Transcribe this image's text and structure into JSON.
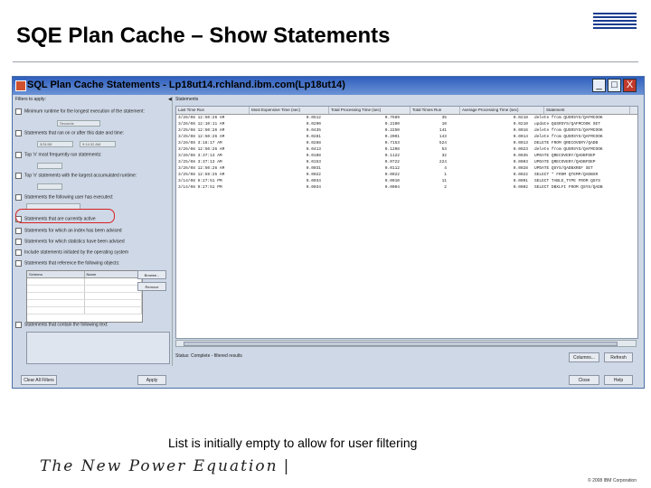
{
  "slide": {
    "title": "SQE Plan Cache – Show Statements",
    "logo": "IBM",
    "caption": "List is initially empty to allow for user filtering",
    "footer_brand": "The New Power Equation",
    "copyright": "© 2008 IBM Corporation"
  },
  "window": {
    "title": "SQL Plan Cache Statements - Lp18ut14.rchland.ibm.com(Lp18ut14)",
    "controls": {
      "minimize": "_",
      "maximize": "□",
      "close": "X"
    },
    "filters_label": "Filters to apply:",
    "filters": [
      {
        "label": "Minimum runtime for the longest execution of the statement:",
        "checked": false
      },
      {
        "label": "Statements that ran on or after this date and time:",
        "checked": false
      },
      {
        "label": "Top 'n' most frequently run statements:",
        "checked": false
      },
      {
        "label": "Top 'n' statements with the largest accumulated runtime:",
        "checked": false
      },
      {
        "label": "Statements the following user has executed:",
        "checked": false
      },
      {
        "label": "Statements that are currently active",
        "checked": false,
        "highlighted": true
      },
      {
        "label": "Statements for which an index has been advised",
        "checked": false
      },
      {
        "label": "Statements for which statistics have been advised",
        "checked": false
      },
      {
        "label": "Include statements initiated by the operating system",
        "checked": false
      },
      {
        "label": "Statements that reference the following objects:",
        "checked": false
      },
      {
        "label": "Statements that contain the following text:",
        "checked": false
      }
    ],
    "subfields": {
      "runtime_unit": "Seconds",
      "date": "3/31/08",
      "time": "9:14:32 AM"
    },
    "object_table": {
      "columns": [
        "Schema",
        "Name"
      ]
    },
    "object_buttons": {
      "browse": "Browse...",
      "remove": "Remove"
    },
    "buttons": {
      "clear_all_filters": "Clear All Filters",
      "apply": "Apply",
      "columns": "Columns...",
      "refresh": "Refresh",
      "close": "Close",
      "help": "Help"
    },
    "statements_label": "Statements",
    "table": {
      "columns": [
        "Last Time Run",
        "Most Expensive Time (sec)",
        "Total Processing Time (sec)",
        "Total Times Run",
        "Average Processing Time (sec)",
        "Statement"
      ],
      "rows": [
        [
          "3/26/08 12:50:26 AM",
          "0.0512",
          "0.7589",
          "35",
          "0.0218",
          "delete from QUSRSYS/QAFMCOOK"
        ],
        [
          "3/26/08 12:10:11 AM",
          "0.0290",
          "0.2100",
          "10",
          "0.0210",
          "update QUSRSYS/QAFMCOOK SET"
        ],
        [
          "3/25/08 12:50:26 AM",
          "0.0435",
          "0.2250",
          "141",
          "0.0016",
          "delete from QUSRSYS/QAFMCOOK"
        ],
        [
          "3/25/08 12:50:26 AM",
          "0.0281",
          "0.2001",
          "143",
          "0.0014",
          "delete from QUSRSYS/QAFMCOOK"
        ],
        [
          "3/26/08 3:18:17 AM",
          "0.0288",
          "0.7153",
          "524",
          "0.0013",
          "DELETE FROM QRECOVERY/QADB"
        ],
        [
          "3/26/08 12:50:26 AM",
          "0.0413",
          "0.1208",
          "53",
          "0.0023",
          "delete from QUSRSYS/QAFMCOOK"
        ],
        [
          "3/26/08 3:37:13 AM",
          "0.0108",
          "0.1122",
          "32",
          "0.0035",
          "UPDATE QRECOVERY/QADBFDEP"
        ],
        [
          "3/25/08 3:37:13 AM",
          "0.0153",
          "0.0722",
          "224",
          "0.0003",
          "UPDATE QRECOVERY/QADBFDEP"
        ],
        [
          "3/26/08 12:50:26 AM",
          "0.0031",
          "0.0112",
          "4",
          "0.0028",
          "UPDATE QSYS/QADBXREF SET"
        ],
        [
          "3/25/08 12:59:25 AM",
          "0.0022",
          "0.0022",
          "1",
          "0.0022",
          "SELECT * FROM QTEMP/QADBXR"
        ],
        [
          "3/14/08 9:27:51 PM",
          "0.0034",
          "0.0010",
          "11",
          "0.0001",
          "SELECT TABLE_TYPE FROM QSYS"
        ],
        [
          "3/14/08 9:27:51 PM",
          "0.0034",
          "0.0004",
          "2",
          "0.0002",
          "SELECT DBXLFI FROM QSYS/QADB"
        ]
      ]
    },
    "status": "Status: Complete - filtered results"
  }
}
